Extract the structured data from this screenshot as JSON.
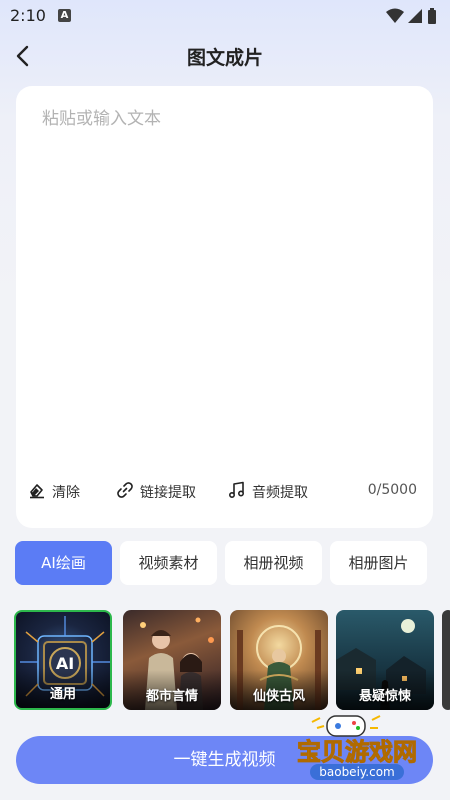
{
  "status_bar": {
    "time": "2:10",
    "notification_letter": "A"
  },
  "header": {
    "title": "图文成片",
    "back_icon": "back-arrow-icon"
  },
  "editor": {
    "placeholder": "粘贴或输入文本",
    "value": "",
    "tools": [
      {
        "label": "清除",
        "icon": "eraser-icon"
      },
      {
        "label": "链接提取",
        "icon": "link-icon"
      },
      {
        "label": "音频提取",
        "icon": "music-note-icon"
      }
    ],
    "counter": "0/5000"
  },
  "tabs": [
    {
      "label": "AI绘画",
      "active": true
    },
    {
      "label": "视频素材",
      "active": false
    },
    {
      "label": "相册视频",
      "active": false
    },
    {
      "label": "相册图片",
      "active": false
    }
  ],
  "styles": [
    {
      "label": "通用",
      "selected": true,
      "badge": "AI"
    },
    {
      "label": "都市言情",
      "selected": false
    },
    {
      "label": "仙侠古风",
      "selected": false
    },
    {
      "label": "悬疑惊悚",
      "selected": false
    }
  ],
  "generate_button": {
    "label": "一键生成视频"
  },
  "watermark": {
    "title": "宝贝游戏网",
    "url": "baobeiy.com"
  },
  "colors": {
    "accent": "#5b7cf5",
    "button": "#6d86f6",
    "selected_border": "#2db84c"
  }
}
